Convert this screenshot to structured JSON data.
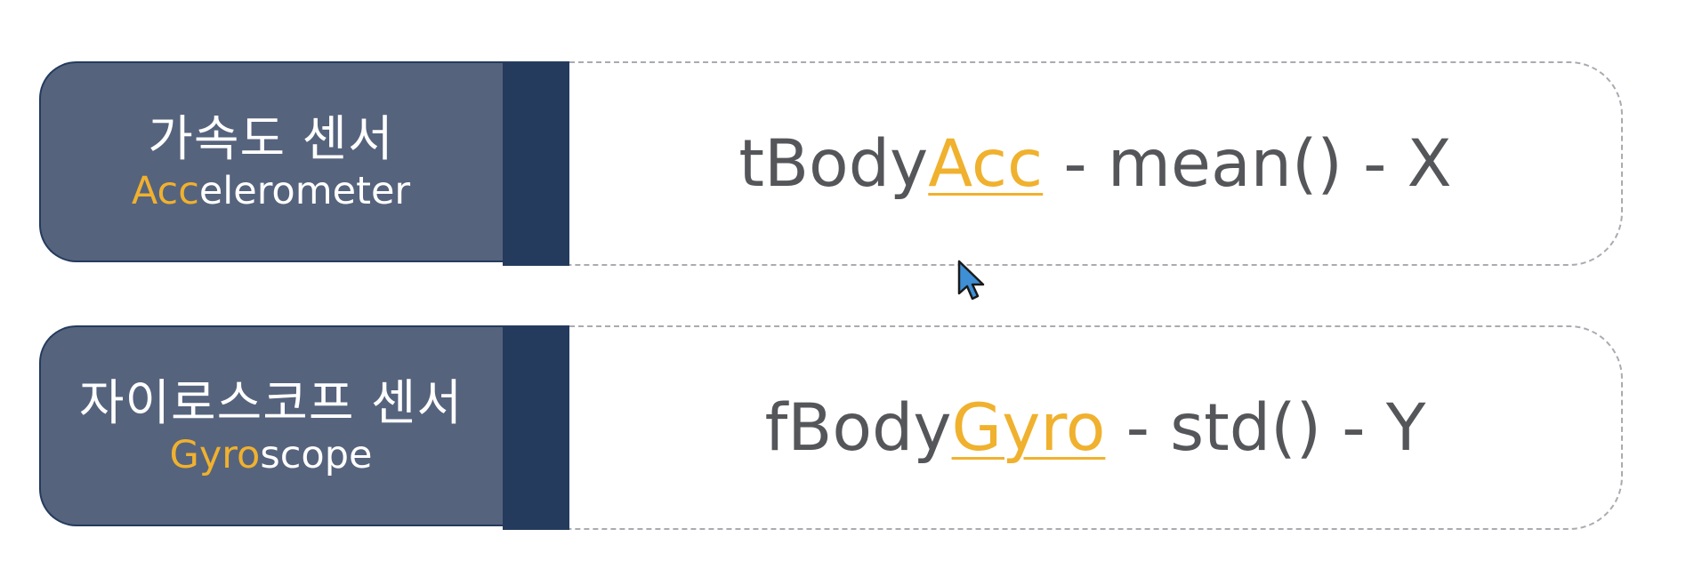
{
  "rows": [
    {
      "label_ko": "가속도 센서",
      "label_en_accent": "Acc",
      "label_en_rest": "elerometer",
      "value_prefix": "tBody",
      "value_accent": "Acc",
      "value_suffix": " - mean() - X"
    },
    {
      "label_ko": "자이로스코프 센서",
      "label_en_accent": "Gyro",
      "label_en_rest": "scope",
      "value_prefix": "fBody",
      "value_accent": "Gyro",
      "value_suffix": " - std() - Y"
    }
  ],
  "colors": {
    "label_bg": "#56637d",
    "label_bar": "#243b5e",
    "accent": "#f0b12e",
    "value_text": "#55565a",
    "dashed_border": "#a9abb0",
    "cursor": "#3f8fd6"
  },
  "icons": {
    "cursor": "mouse-pointer-icon"
  }
}
